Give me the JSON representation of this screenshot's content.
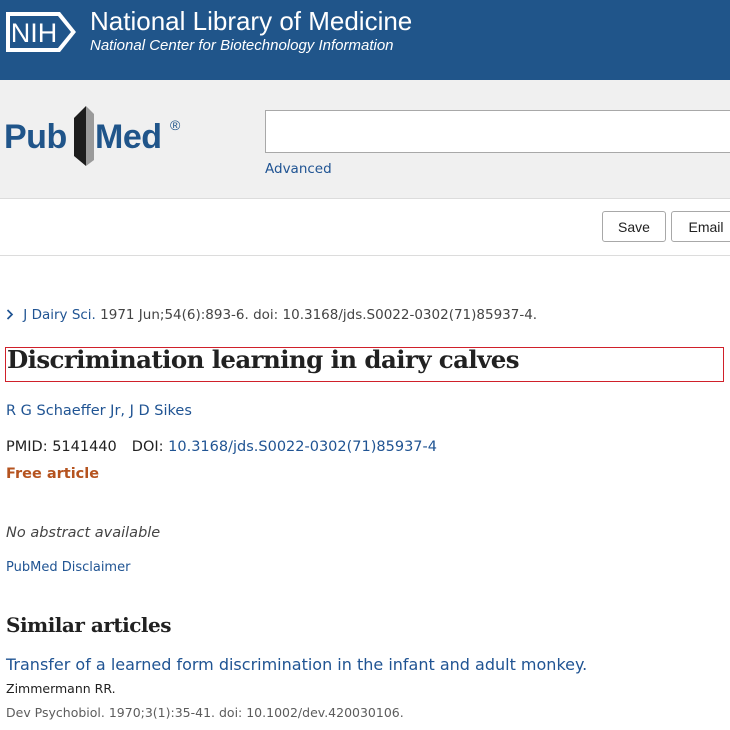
{
  "nih": {
    "logo_text": "NIH",
    "title": "National Library of Medicine",
    "subtitle": "National Center for Biotechnology Information"
  },
  "pubmed": {
    "logo_pub": "Pub",
    "logo_med": "Med",
    "registered": "®"
  },
  "search": {
    "value": "",
    "advanced_label": "Advanced"
  },
  "actions": {
    "save_label": "Save",
    "email_label": "Email"
  },
  "article": {
    "journal": "J Dairy Sci.",
    "citation": " 1971 Jun;54(6):893-6. doi: 10.3168/jds.S0022-0302(71)85937-4.",
    "title": "Discrimination learning in dairy calves",
    "authors": [
      "R G Schaeffer Jr",
      "J D Sikes"
    ],
    "author_sep": ", ",
    "pmid_label": "PMID: ",
    "pmid": "5141440",
    "doi_label": "DOI: ",
    "doi": "10.3168/jds.S0022-0302(71)85937-4",
    "free_label": "Free article",
    "no_abstract": "No abstract available",
    "disclaimer": "PubMed Disclaimer"
  },
  "similar": {
    "heading": "Similar articles",
    "items": [
      {
        "title": "Transfer of a learned form discrimination in the infant and adult monkey.",
        "authors": "Zimmermann RR.",
        "citation": "Dev Psychobiol. 1970;3(1):35-41. doi: 10.1002/dev.420030106."
      }
    ]
  },
  "colors": {
    "banner": "#20558a",
    "link": "#205493",
    "free_article": "#b5531f",
    "title_highlight": "#d0202a"
  }
}
